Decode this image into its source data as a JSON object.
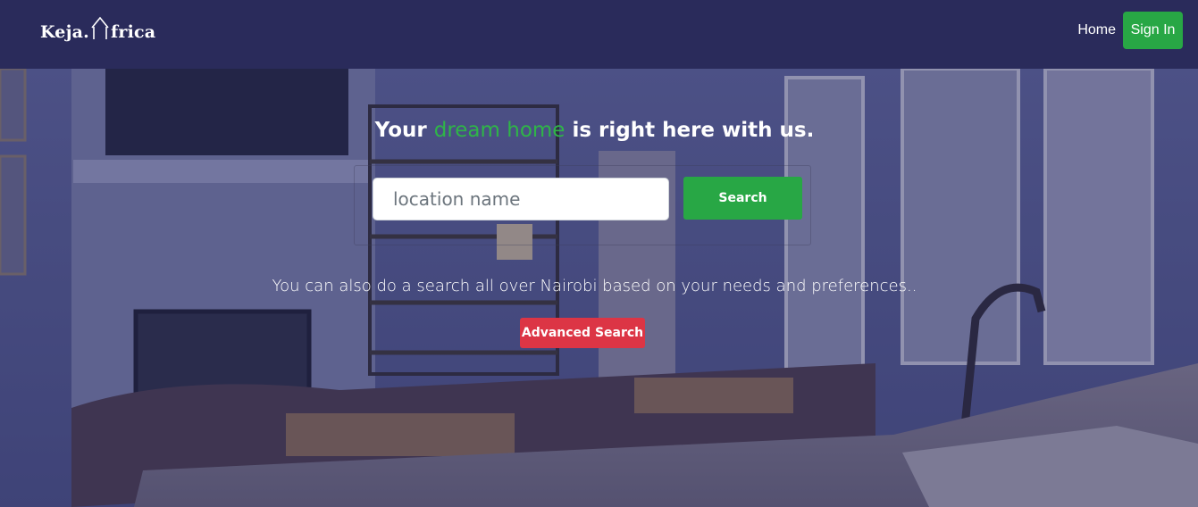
{
  "brand": {
    "name_left": "Keja.",
    "name_right": "frica"
  },
  "nav": {
    "home_label": "Home",
    "signin_label": "Sign In"
  },
  "hero": {
    "headline_pre": "Your ",
    "headline_accent": "dream home",
    "headline_post": " is right here with us.",
    "search_placeholder": "location name",
    "search_value": "",
    "search_button_label": "Search",
    "subtext": "You can also do a search all over Nairobi based on your needs and preferences..",
    "advanced_button_label": "Advanced Search"
  },
  "colors": {
    "navbar": "#2a2b5b",
    "accent_green": "#28a745",
    "accent_red": "#dc3545",
    "headline_accent": "#2fb548"
  },
  "icons": {
    "logo_mark": "house-outline-icon"
  }
}
